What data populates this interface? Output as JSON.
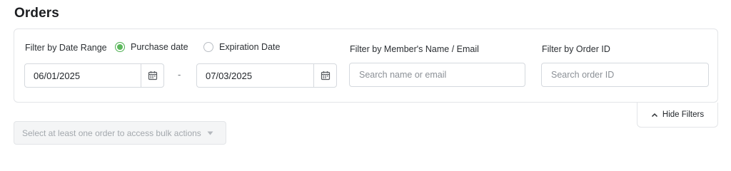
{
  "page": {
    "title": "Orders"
  },
  "filters": {
    "date_range_label": "Filter by Date Range",
    "radio_purchase": "Purchase date",
    "radio_expiration": "Expiration Date",
    "selected_date_type": "purchase",
    "start_date": "06/01/2025",
    "date_separator": "-",
    "end_date": "07/03/2025",
    "member_label": "Filter by Member's Name / Email",
    "member_placeholder": "Search name or email",
    "order_id_label": "Filter by Order ID",
    "order_id_placeholder": "Search order ID",
    "hide_filters_label": "Hide Filters"
  },
  "bulk_actions": {
    "placeholder": "Select at least one order to access bulk actions"
  },
  "colors": {
    "radio_selected": "#5cb85c",
    "border": "#d5d9de"
  },
  "icons": {
    "calendar": "calendar-icon",
    "chevron_up": "chevron-up-icon",
    "caret_down": "caret-down-icon"
  }
}
